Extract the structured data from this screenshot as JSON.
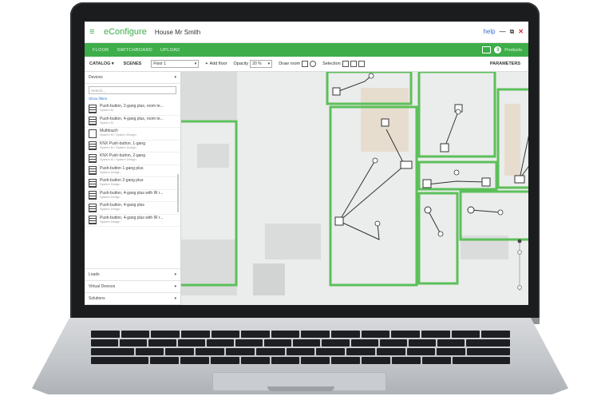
{
  "app": {
    "menu_glyph": "≡",
    "name": "eConfigure",
    "project": "House Mr Smith",
    "window_controls": [
      "help",
      "—",
      "⧉",
      "✕"
    ]
  },
  "nav": {
    "tabs": [
      "FLOOR",
      "SWITCHBOARD",
      "UPLOAD"
    ],
    "cart_count": "3",
    "products_label": "Products"
  },
  "toolbar": {
    "catalog": "CATALOG",
    "scenes": "SCENES",
    "floor_value": "Floor 1",
    "add_floor": "Add floor",
    "opacity_label": "Opacity",
    "opacity_value": "20 %",
    "draw_room": "Draw room",
    "selection": "Selection",
    "parameters": "PARAMETERS"
  },
  "sidebar": {
    "section_devices": "Devices",
    "search_placeholder": "Search...",
    "show_filters": "Show filters",
    "items": [
      {
        "title": "Push-button, 2-gang plus, room te...",
        "sub": "System M"
      },
      {
        "title": "Push-button, 4-gang plus, room te...",
        "sub": "System M"
      },
      {
        "title": "Multitouch",
        "sub": "System M / System Design"
      },
      {
        "title": "KNX Push-button, 1-gang",
        "sub": "System M / System Design"
      },
      {
        "title": "KNX Push-button, 2-gang",
        "sub": "System M / System Design"
      },
      {
        "title": "Push-button 1-gang plus",
        "sub": "System Design"
      },
      {
        "title": "Push-button 2-gang plus",
        "sub": "System Design"
      },
      {
        "title": "Push-button, 4-gang plus with IR r...",
        "sub": "System Design"
      },
      {
        "title": "Push-button, 4-gang plus",
        "sub": "System Design"
      },
      {
        "title": "Push-button, 4-gang plus with IR r...",
        "sub": "System Design"
      }
    ],
    "section_loads": "Loads",
    "section_virtual": "Virtual Devices",
    "section_solutions": "Solutions"
  },
  "colors": {
    "brand_green": "#3dae49",
    "room_outline": "#5cc05a",
    "canvas_bg": "#ebecec"
  }
}
